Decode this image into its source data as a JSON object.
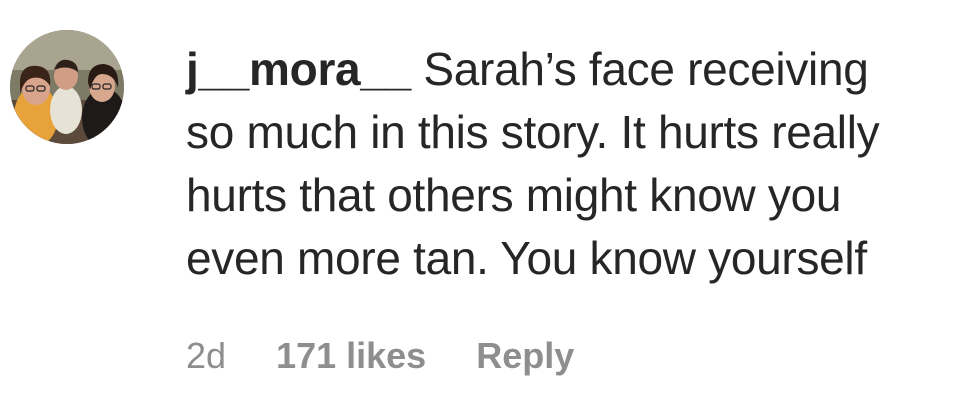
{
  "comment": {
    "username": "j__mora__",
    "text_lines": [
      "Sarah’s face receiving",
      "so much in this story. It hurts really",
      "hurts that others might know you",
      "even more tan. You know yourself"
    ],
    "timestamp": "2d",
    "likes": "171 likes",
    "reply_label": "Reply",
    "avatar_icon": "profile-photo-group"
  },
  "colors": {
    "text": "#262626",
    "meta": "#8e8e8e",
    "background": "#ffffff"
  }
}
